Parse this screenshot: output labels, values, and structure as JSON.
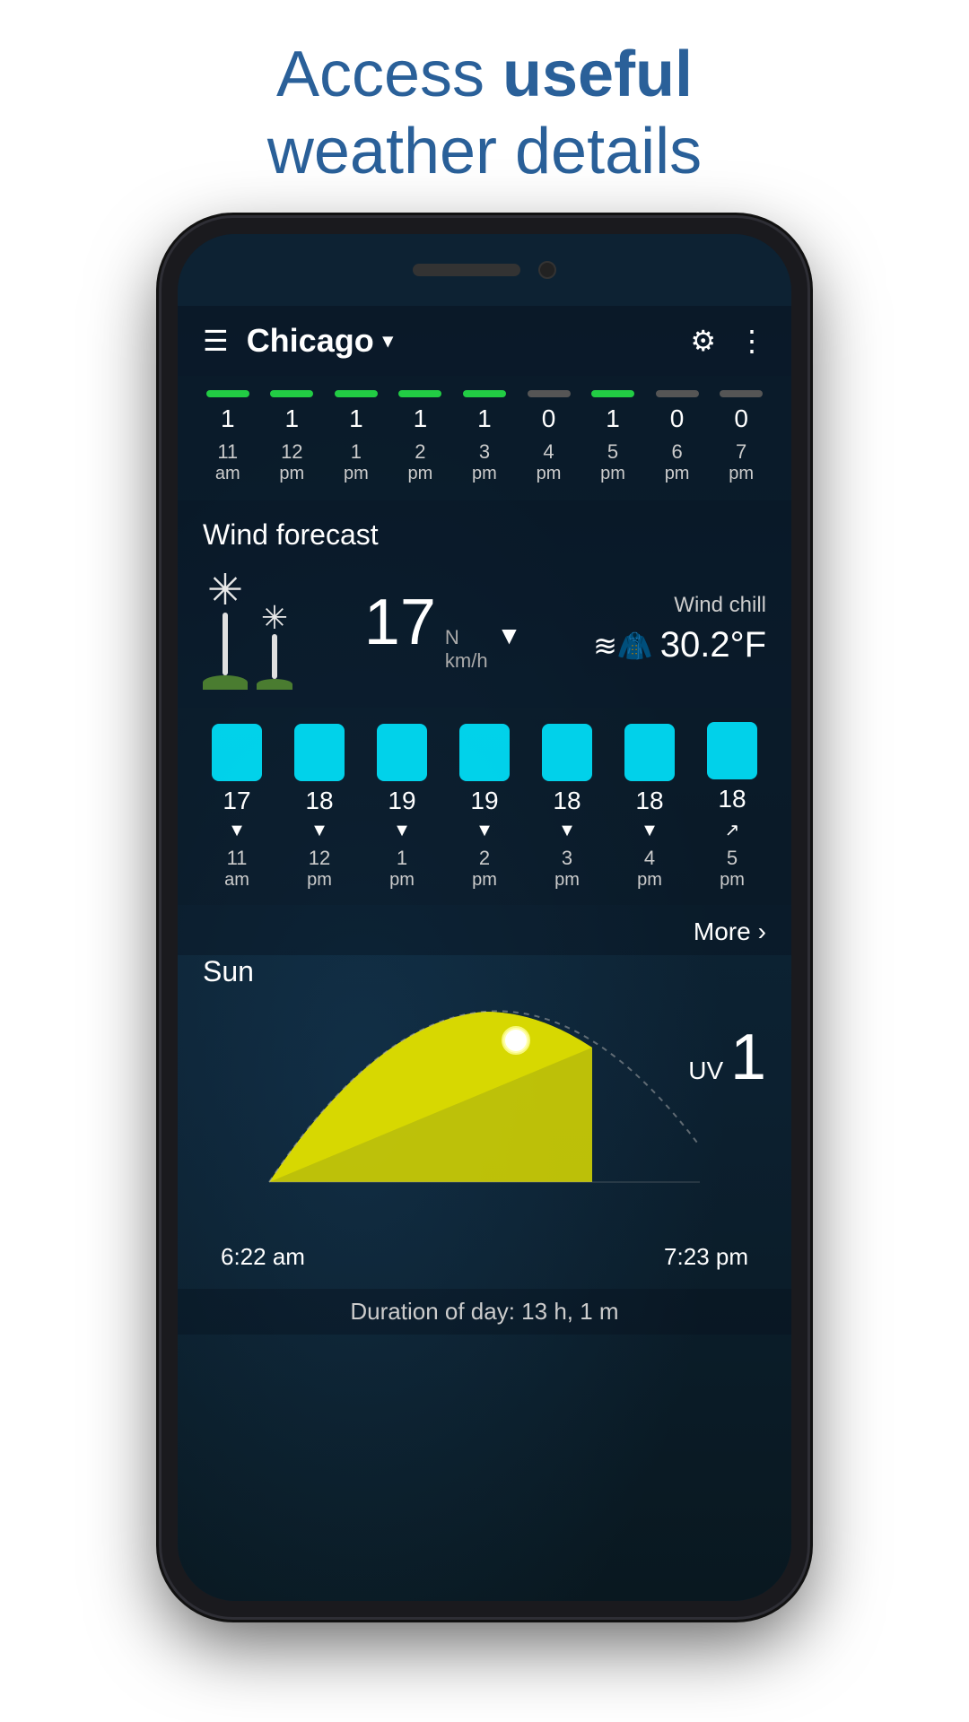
{
  "header": {
    "line1": "Access ",
    "line1_bold": "useful",
    "line2": "weather details"
  },
  "topbar": {
    "city": "Chicago",
    "hamburger": "☰",
    "dropdown": "▾",
    "gear": "⚙",
    "more": "⋮"
  },
  "uv_section": {
    "bars": [
      {
        "value": "1",
        "time": "11",
        "period": "am",
        "color": "green"
      },
      {
        "value": "1",
        "time": "12",
        "period": "pm",
        "color": "green"
      },
      {
        "value": "1",
        "time": "1",
        "period": "pm",
        "color": "green"
      },
      {
        "value": "1",
        "time": "2",
        "period": "pm",
        "color": "green"
      },
      {
        "value": "1",
        "time": "3",
        "period": "pm",
        "color": "green"
      },
      {
        "value": "0",
        "time": "4",
        "period": "pm",
        "color": "gray"
      },
      {
        "value": "1",
        "time": "5",
        "period": "pm",
        "color": "green"
      },
      {
        "value": "0",
        "time": "6",
        "period": "pm",
        "color": "gray"
      },
      {
        "value": "0",
        "time": "7",
        "period": "pm",
        "color": "gray"
      }
    ]
  },
  "wind": {
    "section_title": "Wind forecast",
    "speed": "17",
    "speed_unit": "km/h",
    "direction": "N",
    "arrow": "▼",
    "chill_label": "Wind chill",
    "chill_icon": "≋👕",
    "chill_value": "30.2°F"
  },
  "wind_bars": [
    {
      "speed": "17",
      "arrow": "▼",
      "time": "11",
      "period": "am"
    },
    {
      "speed": "18",
      "arrow": "▼",
      "time": "12",
      "period": "pm"
    },
    {
      "speed": "19",
      "arrow": "▼",
      "time": "1",
      "period": "pm"
    },
    {
      "speed": "19",
      "arrow": "▼",
      "time": "2",
      "period": "pm"
    },
    {
      "speed": "18",
      "arrow": "▼",
      "time": "3",
      "period": "pm"
    },
    {
      "speed": "18",
      "arrow": "▼",
      "time": "4",
      "period": "pm"
    },
    {
      "speed": "18",
      "arrow": "↗",
      "time": "5",
      "period": "pm"
    }
  ],
  "more_btn": "More",
  "more_chevron": "›",
  "sun": {
    "label": "Sun",
    "uv_label": "UV",
    "uv_value": "1",
    "sunrise": "6:22 am",
    "sunset": "7:23 pm",
    "duration": "Duration of day: 13 h, 1 m"
  }
}
